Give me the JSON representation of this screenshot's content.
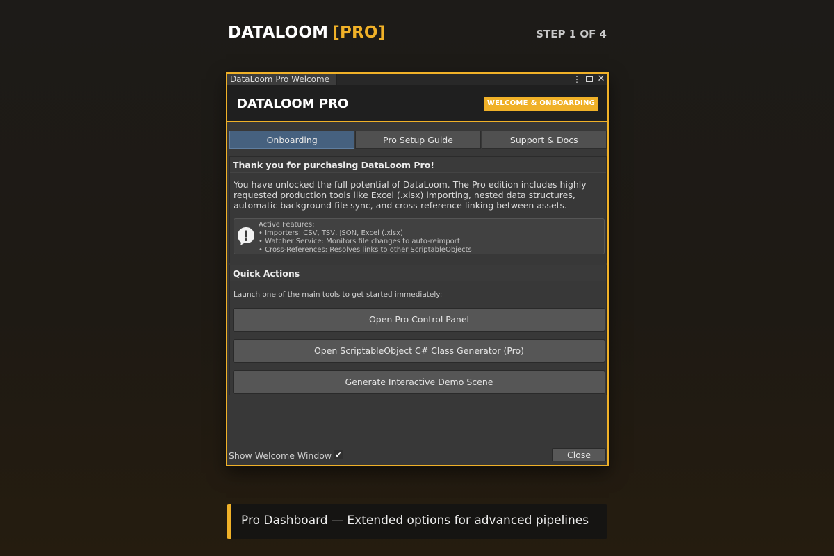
{
  "page": {
    "brand_name": "DATALOOM",
    "brand_tag": "[PRO]",
    "step_text": "STEP 1 OF 4",
    "accent_color": "#f0b128"
  },
  "window": {
    "tab_title": "DataLoom Pro Welcome",
    "header_title": "DATALOOM PRO",
    "header_badge": "WELCOME & ONBOARDING",
    "controls": [
      "more-icon",
      "maximize-icon",
      "close-icon"
    ]
  },
  "tabs": [
    {
      "label": "Onboarding",
      "active": true
    },
    {
      "label": "Pro Setup Guide",
      "active": false
    },
    {
      "label": "Support & Docs",
      "active": false
    }
  ],
  "intro": {
    "heading": "Thank you for purchasing DataLoom Pro!",
    "body": "You have unlocked the full potential of DataLoom. The Pro edition includes highly requested production tools like Excel (.xlsx) importing, nested data structures, automatic background file sync, and cross-reference linking between assets.",
    "help_icon": "info-icon",
    "help_lines": [
      "Active Features:",
      "• Importers: CSV, TSV, JSON, Excel (.xlsx)",
      "• Watcher Service: Monitors file changes to auto-reimport",
      "• Cross-References: Resolves links to other ScriptableObjects"
    ]
  },
  "actions": {
    "heading": "Quick Actions",
    "subtitle": "Launch one of the main tools to get started immediately:",
    "buttons": [
      "Open Pro Control Panel",
      "Open ScriptableObject C# Class Generator (Pro)",
      "Generate Interactive Demo Scene"
    ]
  },
  "footer": {
    "show_label": "Show Welcome Window o",
    "show_checked": true,
    "close_label": "Close"
  },
  "caption": {
    "text": "Pro Dashboard — Extended options for advanced pipelines"
  }
}
